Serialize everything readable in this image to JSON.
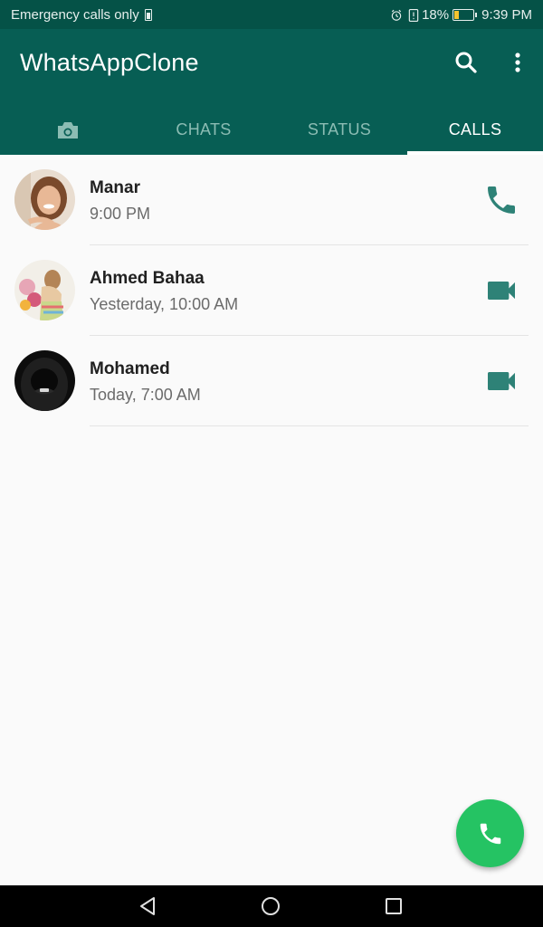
{
  "status_bar": {
    "carrier_text": "Emergency calls only",
    "battery_percent": "18%",
    "time": "9:39 PM",
    "battery_level": 0.18,
    "battery_fill_color": "#f4c430"
  },
  "app_bar": {
    "title": "WhatsAppClone",
    "search_icon": "search-icon",
    "more_icon": "more-vert-icon"
  },
  "tabs": [
    {
      "label": "",
      "icon": "camera-icon"
    },
    {
      "label": "CHATS"
    },
    {
      "label": "STATUS"
    },
    {
      "label": "CALLS",
      "active": true
    }
  ],
  "calls": [
    {
      "name": "Manar",
      "time": "9:00 PM",
      "type": "voice",
      "icon": "phone-icon"
    },
    {
      "name": "Ahmed Bahaa",
      "time": "Yesterday, 10:00 AM",
      "type": "video",
      "icon": "videocam-icon"
    },
    {
      "name": "Mohamed",
      "time": "Today, 7:00 AM",
      "type": "video",
      "icon": "videocam-icon"
    }
  ],
  "fab": {
    "icon": "phone-icon"
  },
  "colors": {
    "primary": "#075e54",
    "status_bar": "#055247",
    "accent_icon": "#2e8277",
    "fab": "#25c363",
    "tab_inactive": "#8bbcb3"
  },
  "nav_bar": {
    "icons": [
      "back-icon",
      "home-icon",
      "recents-icon"
    ]
  }
}
